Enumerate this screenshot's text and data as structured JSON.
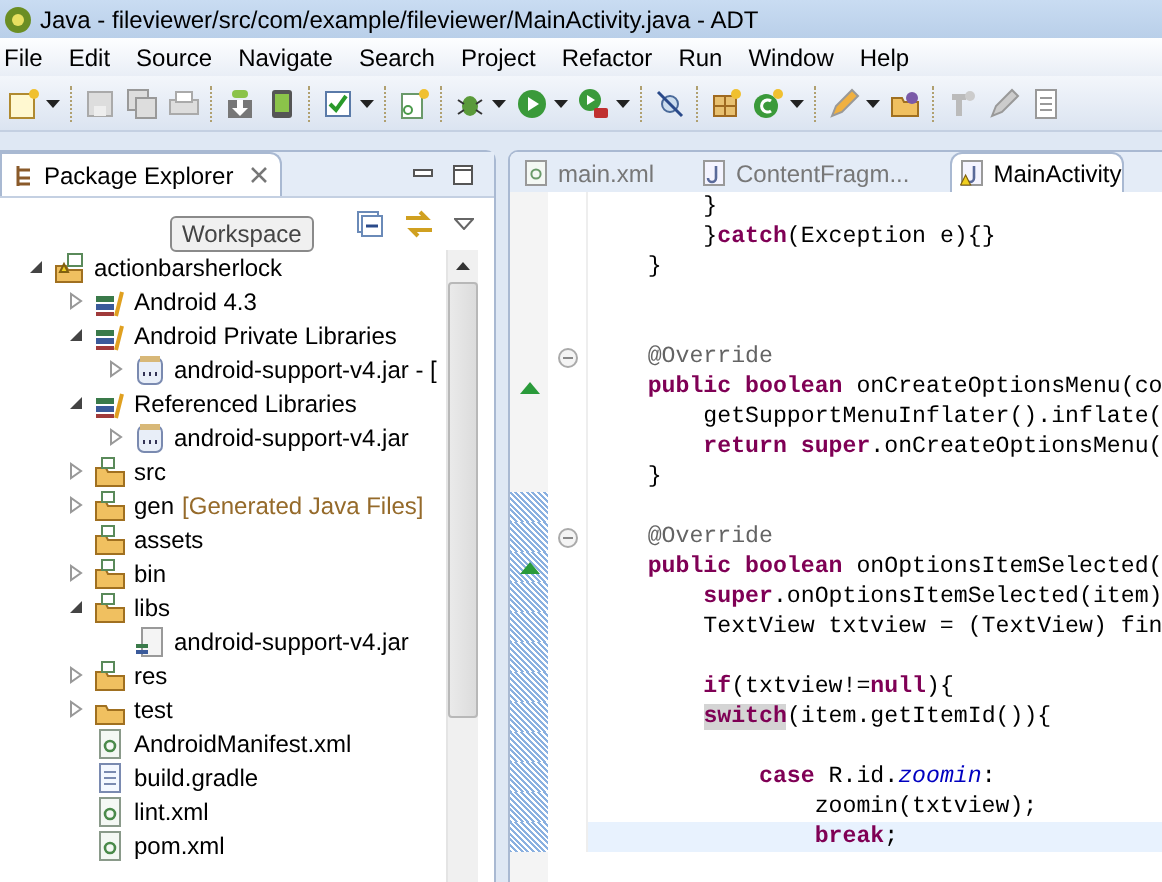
{
  "window": {
    "title": "Java - fileviewer/src/com/example/fileviewer/MainActivity.java - ADT"
  },
  "menu": [
    "File",
    "Edit",
    "Source",
    "Navigate",
    "Search",
    "Project",
    "Refactor",
    "Run",
    "Window",
    "Help"
  ],
  "package_explorer": {
    "tab": {
      "label": "Package Explorer",
      "selected": true
    },
    "tooltip": "Workspace",
    "tree": [
      {
        "label": "actionbarsherlock",
        "kind": "project",
        "has_children": true,
        "expanded": true,
        "children": [
          {
            "label": "Android 4.3",
            "kind": "library",
            "has_children": true,
            "expanded": false
          },
          {
            "label": "Android Private Libraries",
            "kind": "library",
            "has_children": true,
            "expanded": true,
            "children": [
              {
                "label": "android-support-v4.jar - [",
                "kind": "jar",
                "has_children": true,
                "expanded": false
              }
            ]
          },
          {
            "label": "Referenced Libraries",
            "kind": "library",
            "has_children": true,
            "expanded": true,
            "children": [
              {
                "label": "android-support-v4.jar",
                "kind": "jar",
                "has_children": true,
                "expanded": false
              }
            ]
          },
          {
            "label": "src",
            "kind": "source-folder",
            "has_children": true,
            "expanded": false
          },
          {
            "label": "gen",
            "decoration": "[Generated Java Files]",
            "kind": "source-folder",
            "has_children": true,
            "expanded": false
          },
          {
            "label": "assets",
            "kind": "folder",
            "has_children": false,
            "expanded": false
          },
          {
            "label": "bin",
            "kind": "folder",
            "has_children": true,
            "expanded": false
          },
          {
            "label": "libs",
            "kind": "folder",
            "has_children": true,
            "expanded": true,
            "children": [
              {
                "label": "android-support-v4.jar",
                "kind": "jar-file",
                "has_children": false,
                "expanded": false
              }
            ]
          },
          {
            "label": "res",
            "kind": "folder",
            "has_children": true,
            "expanded": false
          },
          {
            "label": "test",
            "kind": "plain-folder",
            "has_children": true,
            "expanded": false
          },
          {
            "label": "AndroidManifest.xml",
            "kind": "xml-file",
            "has_children": false,
            "expanded": false
          },
          {
            "label": "build.gradle",
            "kind": "text-file",
            "has_children": false,
            "expanded": false
          },
          {
            "label": "lint.xml",
            "kind": "xml-file",
            "has_children": false,
            "expanded": false
          },
          {
            "label": "pom.xml",
            "kind": "xml-file",
            "has_children": false,
            "expanded": false
          }
        ]
      }
    ]
  },
  "editor": {
    "tabs": [
      {
        "label": "main.xml",
        "kind": "xml",
        "selected": false
      },
      {
        "label": "ContentFragm...",
        "kind": "java",
        "selected": false
      },
      {
        "label": "MainActivity",
        "kind": "java-warning",
        "selected": true
      }
    ],
    "lines": [
      {
        "parts": [
          {
            "text": "        }",
            "kind": "plain"
          }
        ],
        "fold": false,
        "override": false,
        "changed": false,
        "current": false
      },
      {
        "parts": [
          {
            "text": "        }",
            "kind": "plain"
          },
          {
            "text": "catch",
            "kind": "keyword"
          },
          {
            "text": "(Exception e){}",
            "kind": "plain"
          }
        ],
        "fold": false,
        "override": false,
        "changed": false,
        "current": false
      },
      {
        "parts": [
          {
            "text": "    }",
            "kind": "plain"
          }
        ],
        "fold": false,
        "override": false,
        "changed": false,
        "current": false
      },
      {
        "fold": false,
        "override": false,
        "changed": false,
        "current": false
      },
      {
        "fold": false,
        "override": false,
        "changed": false,
        "current": false
      },
      {
        "parts": [
          {
            "text": "    @Override",
            "kind": "annotation"
          }
        ],
        "fold": true,
        "override": false,
        "changed": false,
        "current": false
      },
      {
        "parts": [
          {
            "text": "    public boolean",
            "kind": "keyword"
          },
          {
            "text": " onCreateOptionsMenu(co",
            "kind": "plain"
          }
        ],
        "fold": false,
        "override": true,
        "changed": false,
        "current": false
      },
      {
        "parts": [
          {
            "text": "        getSupportMenuInflater().inflate(",
            "kind": "plain"
          }
        ],
        "fold": false,
        "override": false,
        "changed": false,
        "current": false
      },
      {
        "parts": [
          {
            "text": "        return super",
            "kind": "keyword"
          },
          {
            "text": ".onCreateOptionsMenu(",
            "kind": "plain"
          }
        ],
        "fold": false,
        "override": false,
        "changed": false,
        "current": false
      },
      {
        "parts": [
          {
            "text": "    }",
            "kind": "plain"
          }
        ],
        "fold": false,
        "override": false,
        "changed": false,
        "current": false
      },
      {
        "fold": false,
        "override": false,
        "changed": true,
        "current": false
      },
      {
        "parts": [
          {
            "text": "    @Override",
            "kind": "annotation"
          }
        ],
        "fold": true,
        "override": false,
        "changed": true,
        "current": false
      },
      {
        "parts": [
          {
            "text": "    public boolean",
            "kind": "keyword"
          },
          {
            "text": " onOptionsItemSelected(",
            "kind": "plain"
          }
        ],
        "fold": false,
        "override": true,
        "changed": true,
        "current": false
      },
      {
        "parts": [
          {
            "text": "        super",
            "kind": "keyword"
          },
          {
            "text": ".onOptionsItemSelected(item)",
            "kind": "plain"
          }
        ],
        "fold": false,
        "override": false,
        "changed": true,
        "current": false
      },
      {
        "parts": [
          {
            "text": "        TextView txtview = (TextView) fin",
            "kind": "plain"
          }
        ],
        "fold": false,
        "override": false,
        "changed": true,
        "current": false
      },
      {
        "fold": false,
        "override": false,
        "changed": true,
        "current": false
      },
      {
        "parts": [
          {
            "text": "        if",
            "kind": "keyword"
          },
          {
            "text": "(txtview!=",
            "kind": "plain"
          },
          {
            "text": "null",
            "kind": "keyword"
          },
          {
            "text": "){",
            "kind": "plain"
          }
        ],
        "fold": false,
        "override": false,
        "changed": true,
        "current": false
      },
      {
        "parts": [
          {
            "text": "switch",
            "kind": "keyword-occurrence"
          },
          {
            "text": "(item.getItemId()){",
            "kind": "plain"
          }
        ],
        "fold": false,
        "override": false,
        "changed": true,
        "current": false
      },
      {
        "fold": false,
        "override": false,
        "changed": true,
        "current": false
      },
      {
        "parts": [
          {
            "text": "            case",
            "kind": "keyword"
          },
          {
            "text": " R.id.",
            "kind": "plain"
          },
          {
            "text": "zoomin",
            "kind": "field"
          },
          {
            "text": ":",
            "kind": "plain"
          }
        ],
        "fold": false,
        "override": false,
        "changed": true,
        "current": false
      },
      {
        "parts": [
          {
            "text": "                zoomin(txtview);",
            "kind": "plain"
          }
        ],
        "fold": false,
        "override": false,
        "changed": true,
        "current": false
      },
      {
        "parts": [
          {
            "text": "                break",
            "kind": "keyword"
          },
          {
            "text": ";",
            "kind": "plain"
          }
        ],
        "fold": false,
        "override": false,
        "changed": true,
        "current": true
      }
    ]
  }
}
